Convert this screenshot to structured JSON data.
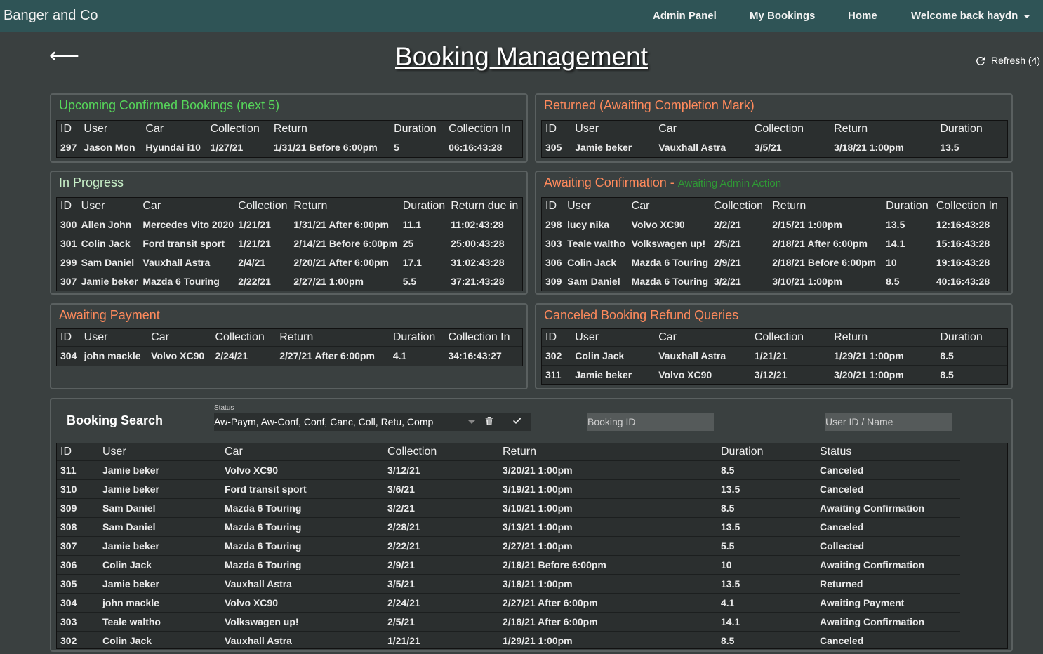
{
  "nav": {
    "brand": "Banger and Co",
    "links": [
      "Admin Panel",
      "My Bookings",
      "Home"
    ],
    "user_menu": "Welcome back haydn"
  },
  "header": {
    "back": "⟵",
    "title": "Booking Management",
    "refresh_label": "Refresh (4)"
  },
  "upcoming": {
    "title": "Upcoming Confirmed Bookings (next 5)",
    "columns": [
      "ID",
      "User",
      "Car",
      "Collection",
      "Return",
      "Duration",
      "Collection In"
    ],
    "rows": [
      [
        "297",
        "Jason Mon",
        "Hyundai i10",
        "1/27/21",
        "1/31/21 Before 6:00pm",
        "5",
        "06:16:43:28"
      ]
    ]
  },
  "returned": {
    "title": "Returned (Awaiting Completion Mark)",
    "columns": [
      "ID",
      "User",
      "Car",
      "Collection",
      "Return",
      "Duration"
    ],
    "rows": [
      [
        "305",
        "Jamie beker",
        "Vauxhall Astra",
        "3/5/21",
        "3/18/21 1:00pm",
        "13.5"
      ]
    ]
  },
  "in_progress": {
    "title": "In Progress",
    "columns": [
      "ID",
      "User",
      "Car",
      "Collection",
      "Return",
      "Duration",
      "Return due in"
    ],
    "rows": [
      [
        "300",
        "Allen John",
        "Mercedes Vito 2020",
        "1/21/21",
        "1/31/21 After 6:00pm",
        "11.1",
        "11:02:43:28"
      ],
      [
        "301",
        "Colin Jack",
        "Ford transit sport",
        "1/21/21",
        "2/14/21 Before 6:00pm",
        "25",
        "25:00:43:28"
      ],
      [
        "299",
        "Sam Daniel",
        "Vauxhall Astra",
        "2/4/21",
        "2/20/21 After 6:00pm",
        "17.1",
        "31:02:43:28"
      ],
      [
        "307",
        "Jamie beker",
        "Mazda 6 Touring",
        "2/22/21",
        "2/27/21 1:00pm",
        "5.5",
        "37:21:43:28"
      ]
    ]
  },
  "awaiting_conf": {
    "title": "Awaiting Confirmation -",
    "subtitle": "Awaiting Admin Action",
    "columns": [
      "ID",
      "User",
      "Car",
      "Collection",
      "Return",
      "Duration",
      "Collection In"
    ],
    "rows": [
      [
        "298",
        "lucy nika",
        "Volvo XC90",
        "2/2/21",
        "2/15/21 1:00pm",
        "13.5",
        "12:16:43:28"
      ],
      [
        "303",
        "Teale waltho",
        "Volkswagen up!",
        "2/5/21",
        "2/18/21 After 6:00pm",
        "14.1",
        "15:16:43:28"
      ],
      [
        "306",
        "Colin Jack",
        "Mazda 6 Touring",
        "2/9/21",
        "2/18/21 Before 6:00pm",
        "10",
        "19:16:43:28"
      ],
      [
        "309",
        "Sam Daniel",
        "Mazda 6 Touring",
        "3/2/21",
        "3/10/21 1:00pm",
        "8.5",
        "40:16:43:28"
      ]
    ]
  },
  "awaiting_payment": {
    "title": "Awaiting Payment",
    "columns": [
      "ID",
      "User",
      "Car",
      "Collection",
      "Return",
      "Duration",
      "Collection In"
    ],
    "rows": [
      [
        "304",
        "john mackle",
        "Volvo XC90",
        "2/24/21",
        "2/27/21 After 6:00pm",
        "4.1",
        "34:16:43:27"
      ]
    ]
  },
  "refund": {
    "title": "Canceled Booking Refund Queries",
    "columns": [
      "ID",
      "User",
      "Car",
      "Collection",
      "Return",
      "Duration"
    ],
    "rows": [
      [
        "302",
        "Colin Jack",
        "Vauxhall Astra",
        "1/21/21",
        "1/29/21 1:00pm",
        "8.5"
      ],
      [
        "311",
        "Jamie beker",
        "Volvo XC90",
        "3/12/21",
        "3/20/21 1:00pm",
        "8.5"
      ]
    ]
  },
  "search": {
    "title": "Booking Search",
    "status_label": "Status",
    "status_value": "Aw-Paym, Aw-Conf, Conf, Canc, Coll, Retu, Comp",
    "booking_id_placeholder": "Booking ID",
    "user_placeholder": "User ID / Name",
    "columns": [
      "ID",
      "User",
      "Car",
      "Collection",
      "Return",
      "Duration",
      "Status"
    ],
    "rows": [
      [
        "311",
        "Jamie beker",
        "Volvo XC90",
        "3/12/21",
        "3/20/21 1:00pm",
        "8.5",
        "Canceled"
      ],
      [
        "310",
        "Jamie beker",
        "Ford transit sport",
        "3/6/21",
        "3/19/21 1:00pm",
        "13.5",
        "Canceled"
      ],
      [
        "309",
        "Sam Daniel",
        "Mazda 6 Touring",
        "3/2/21",
        "3/10/21 1:00pm",
        "8.5",
        "Awaiting Confirmation"
      ],
      [
        "308",
        "Sam Daniel",
        "Mazda 6 Touring",
        "2/28/21",
        "3/13/21 1:00pm",
        "13.5",
        "Canceled"
      ],
      [
        "307",
        "Jamie beker",
        "Mazda 6 Touring",
        "2/22/21",
        "2/27/21 1:00pm",
        "5.5",
        "Collected"
      ],
      [
        "306",
        "Colin Jack",
        "Mazda 6 Touring",
        "2/9/21",
        "2/18/21 Before 6:00pm",
        "10",
        "Awaiting Confirmation"
      ],
      [
        "305",
        "Jamie beker",
        "Vauxhall Astra",
        "3/5/21",
        "3/18/21 1:00pm",
        "13.5",
        "Returned"
      ],
      [
        "304",
        "john mackle",
        "Volvo XC90",
        "2/24/21",
        "2/27/21 After 6:00pm",
        "4.1",
        "Awaiting Payment"
      ],
      [
        "303",
        "Teale waltho",
        "Volkswagen up!",
        "2/5/21",
        "2/18/21 After 6:00pm",
        "14.1",
        "Awaiting Confirmation"
      ],
      [
        "302",
        "Colin Jack",
        "Vauxhall Astra",
        "1/21/21",
        "1/29/21 1:00pm",
        "8.5",
        "Canceled"
      ]
    ]
  },
  "colors": {
    "navbar": "#2f5456",
    "background": "#3a4040",
    "green_title": "#56d65a",
    "orange_title": "#ff8a5c"
  },
  "icons": {
    "refresh": "refresh-icon",
    "trash": "trash-icon",
    "check": "check-icon",
    "back": "back-arrow-icon"
  }
}
